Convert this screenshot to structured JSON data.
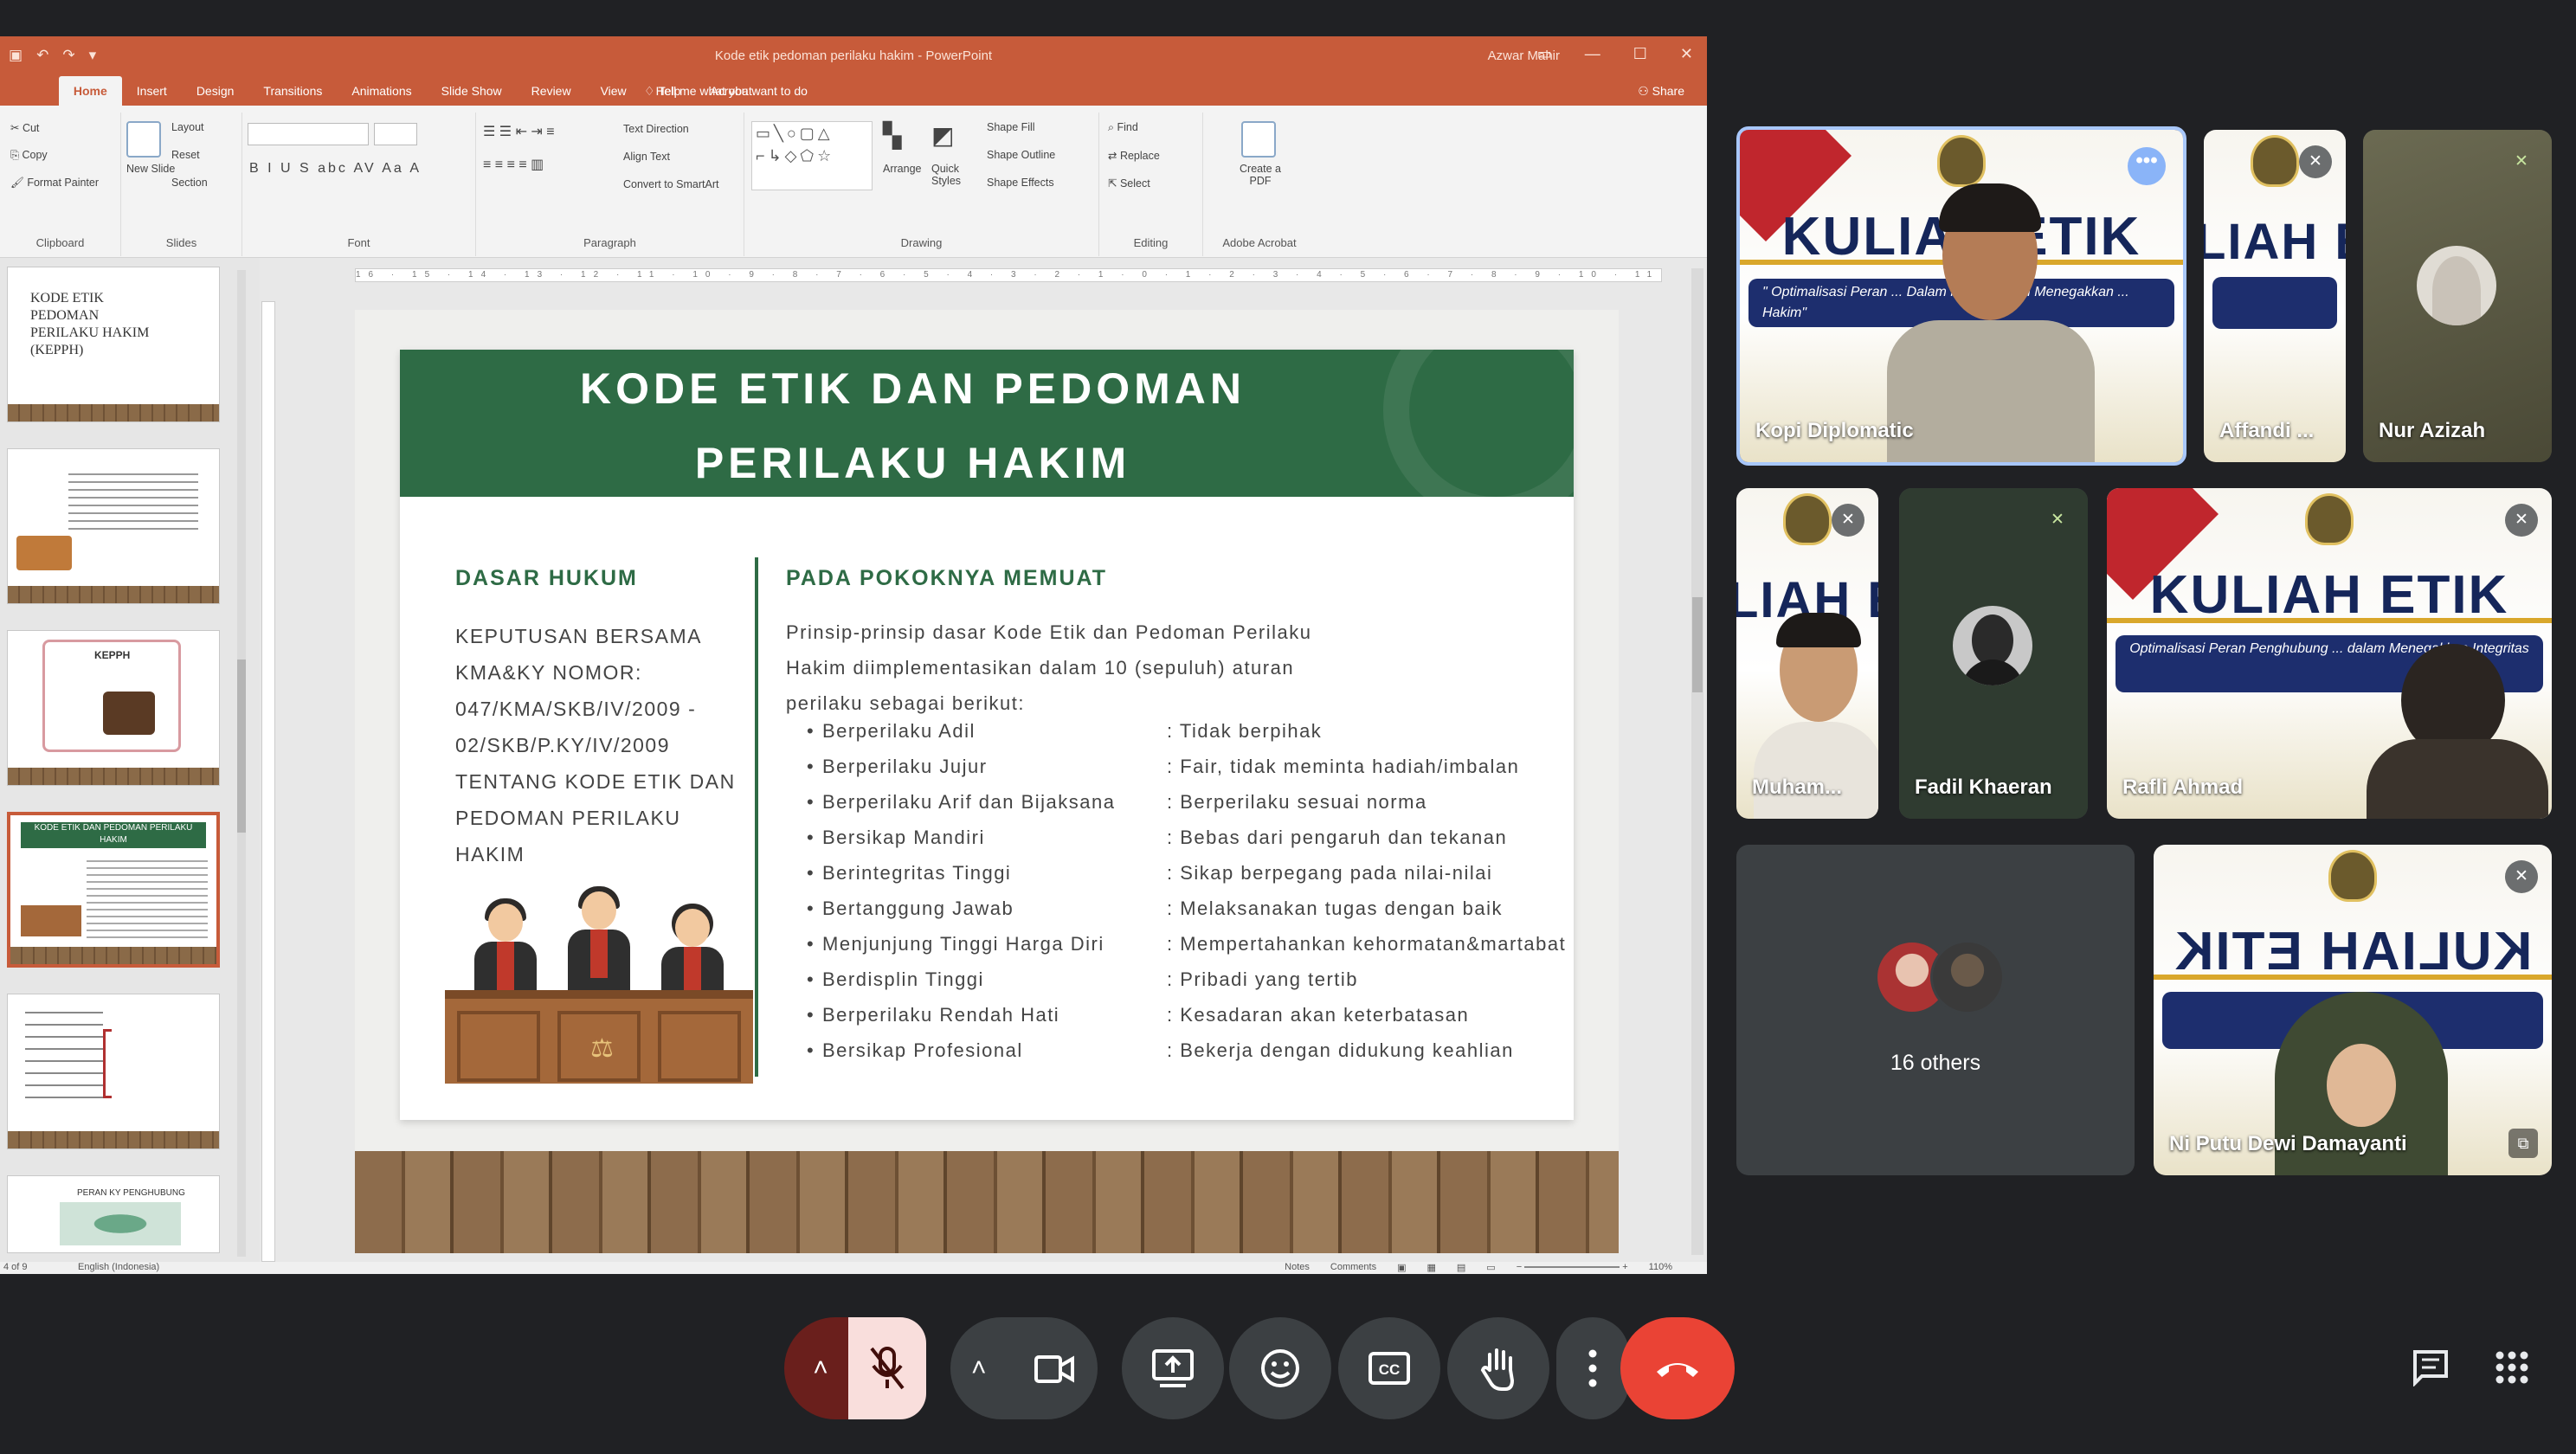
{
  "window": {
    "title": "Kode etik pedoman perilaku hakim - PowerPoint",
    "user": "Azwar Mahir",
    "ribbon_tabs": [
      "Home",
      "Insert",
      "Design",
      "Transitions",
      "Animations",
      "Slide Show",
      "Review",
      "View",
      "Help",
      "Acrobat"
    ],
    "active_tab": "Home",
    "tell_me": "Tell me what you want to do",
    "share": "Share"
  },
  "ribbon": {
    "clipboard": {
      "label": "Clipboard",
      "cut": "Cut",
      "copy": "Copy",
      "format_painter": "Format Painter"
    },
    "slides": {
      "label": "Slides",
      "new_slide": "New Slide",
      "layout": "Layout",
      "reset": "Reset",
      "section": "Section"
    },
    "font": {
      "label": "Font",
      "buttons": "B  I  U  S  abc  AV  Aa  A"
    },
    "paragraph": {
      "label": "Paragraph",
      "text_direction": "Text Direction",
      "align_text": "Align Text",
      "smartart": "Convert to SmartArt"
    },
    "drawing": {
      "label": "Drawing",
      "arrange": "Arrange",
      "quick_styles": "Quick Styles",
      "shape_fill": "Shape Fill",
      "shape_outline": "Shape Outline",
      "shape_effects": "Shape Effects"
    },
    "editing": {
      "label": "Editing",
      "find": "Find",
      "replace": "Replace",
      "select": "Select"
    },
    "acrobat": {
      "label": "Adobe Acrobat",
      "create_pdf": "Create a PDF"
    }
  },
  "thumbnails": [
    {
      "title": "KODE ETIK PEDOMAN PERILAKU HAKIM (KEPPH)"
    },
    {
      "title": ""
    },
    {
      "title": "KEPPH"
    },
    {
      "title": "KODE ETIK DAN PEDOMAN PERILAKU HAKIM"
    },
    {
      "title": ""
    },
    {
      "title": "PERAN KY PENGHUBUNG"
    }
  ],
  "slide": {
    "title_line1": "KODE ETIK DAN PEDOMAN",
    "title_line2": "PERILAKU HAKIM",
    "left_heading": "DASAR HUKUM",
    "left_body": [
      "KEPUTUSAN BERSAMA",
      "KMA&KY NOMOR:",
      "047/KMA/SKB/IV/2009 -",
      "02/SKB/P.KY/IV/2009",
      "TENTANG KODE ETIK DAN",
      "PEDOMAN PERILAKU HAKIM"
    ],
    "right_heading": "PADA POKOKNYA MEMUAT",
    "right_intro": [
      "Prinsip-prinsip dasar Kode Etik dan Pedoman Perilaku",
      "Hakim diimplementasikan dalam 10 (sepuluh) aturan",
      "perilaku sebagai berikut:"
    ],
    "rules": [
      {
        "name": "Berperilaku Adil",
        "desc": ": Tidak berpihak"
      },
      {
        "name": "Berperilaku Jujur",
        "desc": ": Fair, tidak meminta hadiah/imbalan"
      },
      {
        "name": "Berperilaku Arif dan Bijaksana",
        "desc": ": Berperilaku sesuai norma"
      },
      {
        "name": "Bersikap Mandiri",
        "desc": ": Bebas dari pengaruh dan tekanan"
      },
      {
        "name": "Berintegritas Tinggi",
        "desc": ": Sikap berpegang pada nilai-nilai"
      },
      {
        "name": "Bertanggung Jawab",
        "desc": ": Melaksanakan tugas dengan baik"
      },
      {
        "name": "Menjunjung Tinggi Harga Diri",
        "desc": ": Mempertahankan kehormatan&martabat"
      },
      {
        "name": "Berdisplin Tinggi",
        "desc": ": Pribadi yang tertib"
      },
      {
        "name": "Berperilaku Rendah Hati",
        "desc": ": Kesadaran akan keterbatasan"
      },
      {
        "name": "Bersikap Profesional",
        "desc": ": Bekerja dengan didukung keahlian"
      }
    ]
  },
  "statusbar": {
    "slide_counter": "4 of 9",
    "language": "English (Indonesia)",
    "notes": "Notes",
    "comments": "Comments",
    "zoom": "110%"
  },
  "participants": [
    {
      "name": "Kopi Diplomatic",
      "poster_title": "KULIAH ETIK"
    },
    {
      "name": "Affandi ...",
      "poster_title": "LIAH ET"
    },
    {
      "name": "Nur Azizah"
    },
    {
      "name": "Muham...",
      "poster_title": "LIAH ET"
    },
    {
      "name": "Fadil Khaeran"
    },
    {
      "name": "Rafli Ahmad",
      "poster_title": "KULIAH ETIK",
      "poster_sub": "Optimalisasi Peran Penghubung ... dalam Menegakkan Integritas"
    },
    {
      "name": "Ni Putu Dewi Damayanti",
      "poster_title": "KULIAH ETIK"
    }
  ],
  "poster_sub_main": "\" Optimalisasi Peran ... Dalam Menjaga dan Menegakkan ... Hakim\"",
  "others": {
    "label": "16 others"
  },
  "controls": {
    "mic": "mic-off",
    "camera": "camera",
    "present": "present-screen",
    "reactions": "emoji",
    "captions": "CC",
    "raise_hand": "hand",
    "more": "more-options",
    "leave": "leave-call"
  },
  "colors": {
    "accent_green": "#2e6b45",
    "ppt_orange": "#c75b3a",
    "meet_bg": "#202124",
    "leave_red": "#ea4335"
  }
}
